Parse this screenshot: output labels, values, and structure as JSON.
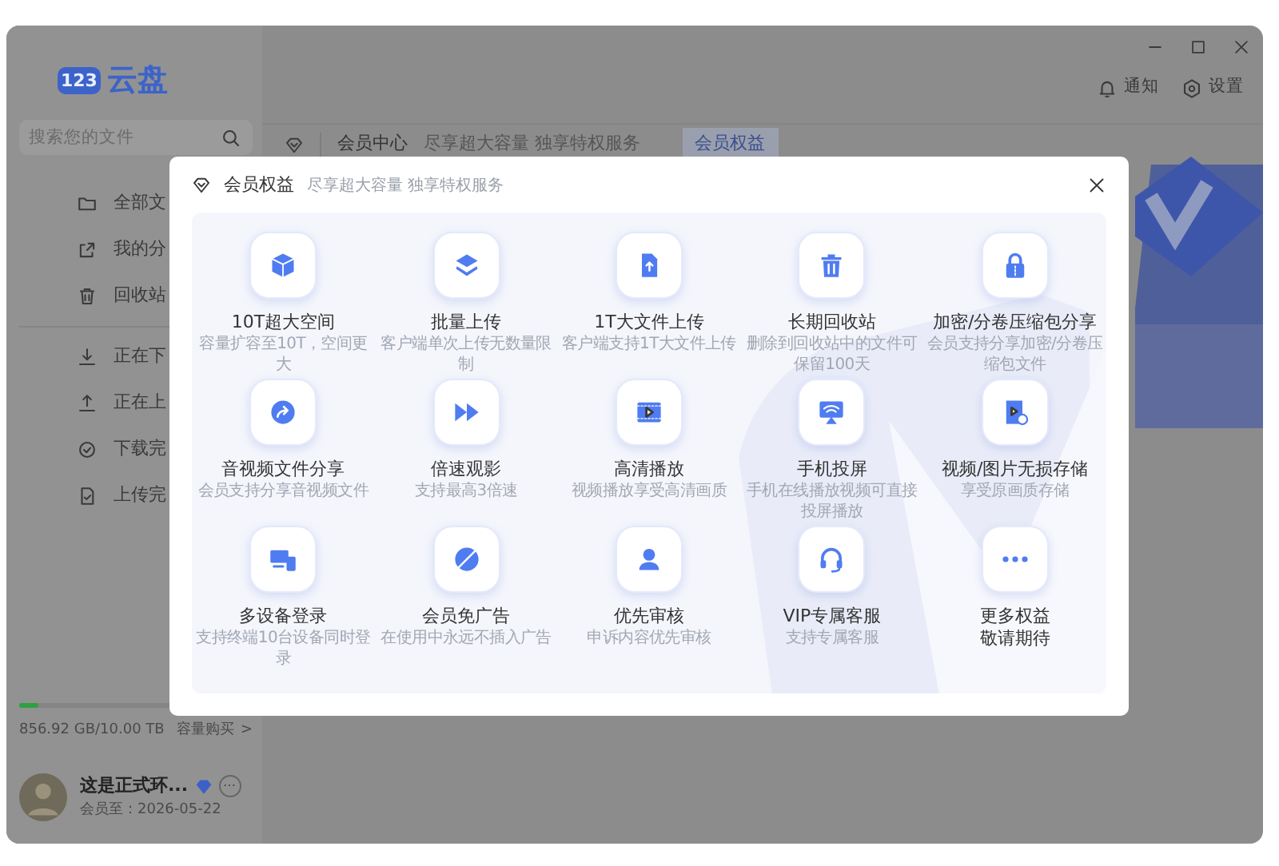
{
  "sidebar": {
    "logo_badge": "123",
    "logo_text": "云盘",
    "search": {
      "placeholder": "搜索您的文件"
    },
    "items": [
      {
        "label": "全部文",
        "selected": false
      },
      {
        "label": "我的分",
        "selected": false
      },
      {
        "label": "回收站",
        "selected": false
      },
      {
        "label": "正在下",
        "selected": false
      },
      {
        "label": "正在上",
        "selected": false
      },
      {
        "label": "下载完",
        "selected": false
      },
      {
        "label": "上传完",
        "selected": false
      }
    ],
    "storage": {
      "level": 0.08,
      "usage": "856.92 GB/10.00 TB",
      "buy_link": "容量购买",
      "buy_arrow": ">"
    },
    "user": {
      "name": "这是正式环...",
      "expiry": "会员至：2026-05-22",
      "more": "⋯"
    }
  },
  "toolbar": {
    "buttons": [
      "通知",
      "设置"
    ]
  },
  "header": {
    "title": "会员中心",
    "subtitle": "尽享超大容量 独享特权服务",
    "tabs": [
      {
        "label": "会员权益",
        "selected": true
      }
    ]
  },
  "dialog": {
    "title": "会员权益",
    "subtitle": "尽享超大容量 独享特权服务",
    "benefits": [
      {
        "kind": "benefit",
        "title": "10T超大空间",
        "desc": "容量扩容至10T，空间更大"
      },
      {
        "kind": "benefit",
        "title": "批量上传",
        "desc": "客户端单次上传无数量限制"
      },
      {
        "kind": "benefit",
        "title": "1T大文件上传",
        "desc": "客户端支持1T大文件上传"
      },
      {
        "kind": "benefit",
        "title": "长期回收站",
        "desc": "删除到回收站中的文件可保留100天"
      },
      {
        "kind": "benefit",
        "title": "加密/分卷压缩包分享",
        "desc": "会员支持分享加密/分卷压缩包文件"
      },
      {
        "kind": "benefit",
        "title": "音视频文件分享",
        "desc": "会员支持分享音视频文件"
      },
      {
        "kind": "benefit",
        "title": "倍速观影",
        "desc": "支持最高3倍速"
      },
      {
        "kind": "benefit",
        "title": "高清播放",
        "desc": "视频播放享受高清画质"
      },
      {
        "kind": "benefit",
        "title": "手机投屏",
        "desc": "手机在线播放视频可直接投屏播放"
      },
      {
        "kind": "benefit",
        "title": "视频/图片无损存储",
        "desc": "享受原画质存储"
      },
      {
        "kind": "benefit",
        "title": "多设备登录",
        "desc": "支持终端10台设备同时登录"
      },
      {
        "kind": "benefit",
        "title": "会员免广告",
        "desc": "在使用中永远不插入广告"
      },
      {
        "kind": "benefit",
        "title": "优先审核",
        "desc": "申诉内容优先审核"
      },
      {
        "kind": "benefit",
        "title": "VIP专属客服",
        "desc": "支持专属客服"
      },
      {
        "kind": "more",
        "title": "更多权益",
        "desc": "敬请期待"
      }
    ]
  }
}
